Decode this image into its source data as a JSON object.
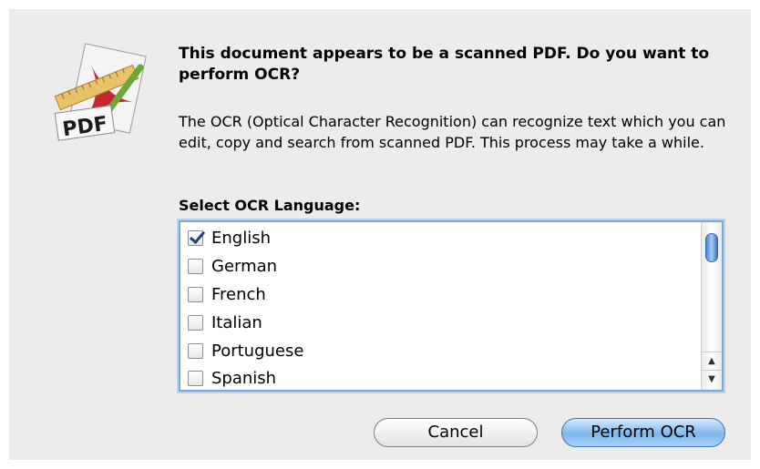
{
  "dialog": {
    "headline": "This document appears to be a scanned PDF. Do you want to perform OCR?",
    "body": "The OCR (Optical Character Recognition) can recognize text which you can edit, copy and search from scanned PDF. This process may take a while.",
    "language_label": "Select OCR Language:",
    "icon": "pdf-document-icon",
    "icon_text": "PDF"
  },
  "languages": [
    {
      "label": "English",
      "checked": true
    },
    {
      "label": "German",
      "checked": false
    },
    {
      "label": "French",
      "checked": false
    },
    {
      "label": "Italian",
      "checked": false
    },
    {
      "label": "Portuguese",
      "checked": false
    },
    {
      "label": "Spanish",
      "checked": false
    }
  ],
  "buttons": {
    "cancel": "Cancel",
    "perform": "Perform OCR"
  },
  "colors": {
    "accent": "#7fb6ee",
    "checkmark": "#243f7a"
  }
}
